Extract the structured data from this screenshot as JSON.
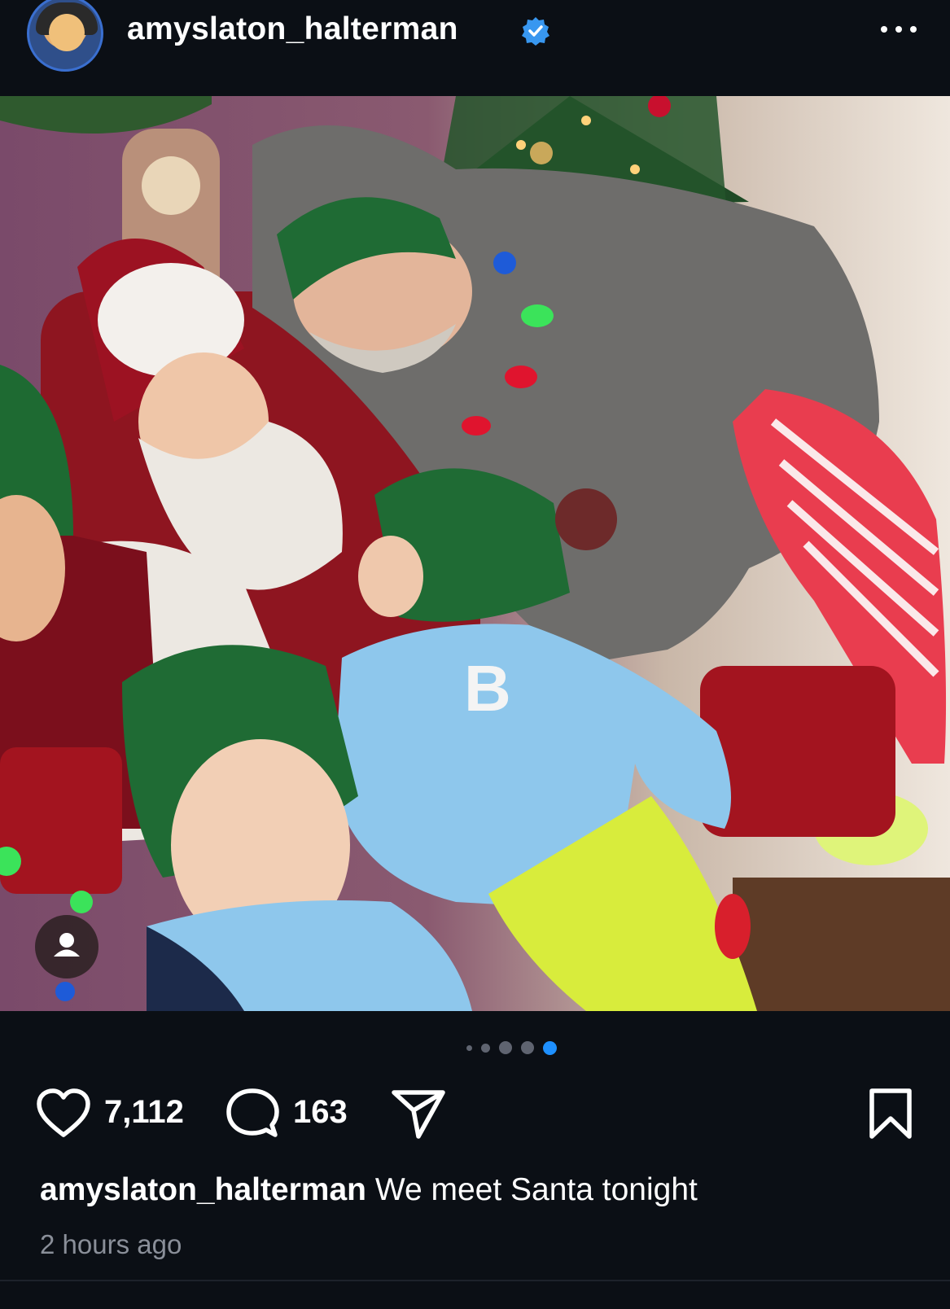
{
  "header": {
    "username": "amyslaton_halterman",
    "verified": true,
    "more_icon": "ellipsis-icon"
  },
  "photo": {
    "carousel_index": 5,
    "carousel_total": 5
  },
  "actions": {
    "likes": "7,112",
    "comments": "163",
    "like_icon": "heart-icon",
    "comment_icon": "comment-bubble-icon",
    "share_icon": "send-icon",
    "save_icon": "bookmark-icon"
  },
  "caption": {
    "username": "amyslaton_halterman",
    "text": "We meet Santa tonight"
  },
  "timestamp": "2 hours ago",
  "colors": {
    "background": "#0b0f15",
    "verified_blue": "#3897f0",
    "active_dot": "#1e90ff",
    "inactive_dot": "#5f6470",
    "muted_text": "#8a8f99"
  }
}
